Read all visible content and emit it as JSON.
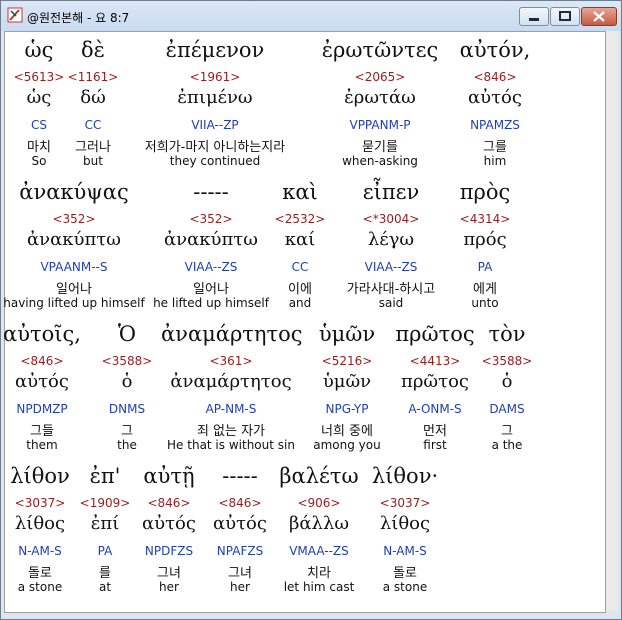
{
  "window": {
    "title": "@원전본해 - 요 8:7"
  },
  "rows": [
    [
      {
        "greek": "ὡς",
        "strong": "<5613>",
        "lemma": "ὡς",
        "parse": "CS",
        "korean": "마치",
        "english": "So"
      },
      {
        "greek": "δὲ",
        "strong": "<1161>",
        "lemma": "δώ",
        "parse": "CC",
        "korean": "그러나",
        "english": "but"
      },
      {
        "greek": "ἐπέμενον",
        "strong": "<1961>",
        "lemma": "ἐπιμένω",
        "parse": "VIIA--ZP",
        "korean": "저희가-마지 아니하는지라",
        "english": "they continued"
      },
      {
        "greek": "ἐρωτῶντες",
        "strong": "<2065>",
        "lemma": "ἐρωτάω",
        "parse": "VPPANM-P",
        "korean": "묻기를",
        "english": "when-asking"
      },
      {
        "greek": "αὐτόν,",
        "strong": "<846>",
        "lemma": "αὐτός",
        "parse": "NPAMZS",
        "korean": "그를",
        "english": "him"
      }
    ],
    [
      {
        "greek": "ἀνακύψας",
        "strong": "<352>",
        "lemma": "ἀνακύπτω",
        "parse": "VPAANM--S",
        "korean": "일어나",
        "english": "having lifted up himself"
      },
      {
        "greek": "-----",
        "strong": "<352>",
        "lemma": "ἀνακύπτω",
        "parse": "VIAA--ZS",
        "korean": "일어나",
        "english": "he lifted up himself"
      },
      {
        "greek": "καὶ",
        "strong": "<2532>",
        "lemma": "καί",
        "parse": "CC",
        "korean": "이에",
        "english": "and"
      },
      {
        "greek": "εἶπεν",
        "strong": "<*3004>",
        "lemma": "λέγω",
        "parse": "VIAA--ZS",
        "korean": "가라사대-하시고",
        "english": "said"
      },
      {
        "greek": "πρὸς",
        "strong": "<4314>",
        "lemma": "πρός",
        "parse": "PA",
        "korean": "에게",
        "english": "unto"
      }
    ],
    [
      {
        "greek": "αὐτοῖς,",
        "strong": "<846>",
        "lemma": "αὐτός",
        "parse": "NPDMZP",
        "korean": "그들",
        "english": "them"
      },
      {
        "greek": "Ὁ",
        "strong": "<3588>",
        "lemma": "ὁ",
        "parse": "DNMS",
        "korean": "그",
        "english": "the"
      },
      {
        "greek": "ἀναμάρτητος",
        "strong": "<361>",
        "lemma": "ἀναμάρτητος",
        "parse": "AP-NM-S",
        "korean": "죄 없는 자가",
        "english": "He that is without sin"
      },
      {
        "greek": "ὑμῶν",
        "strong": "<5216>",
        "lemma": "ὑμῶν",
        "parse": "NPG-YP",
        "korean": "너희 중에",
        "english": "among you"
      },
      {
        "greek": "πρῶτος",
        "strong": "<4413>",
        "lemma": "πρῶτος",
        "parse": "A-ONM-S",
        "korean": "먼저",
        "english": "first"
      },
      {
        "greek": "τὸν",
        "strong": "<3588>",
        "lemma": "ὁ",
        "parse": "DAMS",
        "korean": "그",
        "english": "a the"
      }
    ],
    [
      {
        "greek": "λίθον",
        "strong": "<3037>",
        "lemma": "λίθος",
        "parse": "N-AM-S",
        "korean": "돌로",
        "english": "a stone"
      },
      {
        "greek": "ἐπ'",
        "strong": "<1909>",
        "lemma": "ἐπί",
        "parse": "PA",
        "korean": "를",
        "english": "at"
      },
      {
        "greek": "αὐτῇ",
        "strong": "<846>",
        "lemma": "αὐτός",
        "parse": "NPDFZS",
        "korean": "그녀",
        "english": "her"
      },
      {
        "greek": "-----",
        "strong": "<846>",
        "lemma": "αὐτός",
        "parse": "NPAFZS",
        "korean": "그녀",
        "english": "her"
      },
      {
        "greek": "βαλέτω",
        "strong": "<906>",
        "lemma": "βάλλω",
        "parse": "VMAA--ZS",
        "korean": "치라",
        "english": "let him cast"
      },
      {
        "greek": "λίθον·",
        "strong": "<3037>",
        "lemma": "λίθος",
        "parse": "N-AM-S",
        "korean": "돌로",
        "english": "a stone"
      }
    ]
  ]
}
